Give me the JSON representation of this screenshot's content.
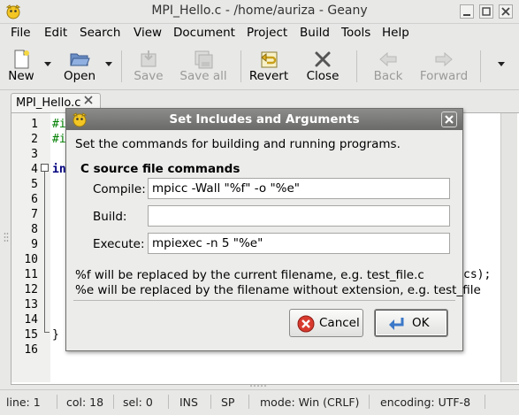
{
  "window": {
    "title": "MPI_Hello.c - /home/auriza - Geany",
    "icon": "geany-icon",
    "controls": [
      "minimize-icon",
      "maximize-icon",
      "close-icon"
    ]
  },
  "menubar": {
    "items": [
      {
        "label": "File"
      },
      {
        "label": "Edit"
      },
      {
        "label": "Search"
      },
      {
        "label": "View"
      },
      {
        "label": "Document"
      },
      {
        "label": "Project"
      },
      {
        "label": "Build"
      },
      {
        "label": "Tools"
      },
      {
        "label": "Help"
      }
    ]
  },
  "toolbar": {
    "buttons": [
      {
        "label": "New",
        "icon": "new-file-icon",
        "enabled": true
      },
      {
        "label": "Open",
        "icon": "open-folder-icon",
        "enabled": true
      },
      {
        "label": "Save",
        "icon": "save-icon",
        "enabled": false
      },
      {
        "label": "Save all",
        "icon": "save-all-icon",
        "enabled": false
      },
      {
        "label": "Revert",
        "icon": "revert-icon",
        "enabled": true
      },
      {
        "label": "Close",
        "icon": "close-x-icon",
        "enabled": true
      },
      {
        "label": "Back",
        "icon": "back-arrow-icon",
        "enabled": false
      },
      {
        "label": "Forward",
        "icon": "forward-arrow-icon",
        "enabled": false
      }
    ]
  },
  "editor": {
    "tab": {
      "label": "MPI_Hello.c"
    },
    "line_numbers": [
      "1",
      "2",
      "3",
      "4",
      "5",
      "6",
      "7",
      "8",
      "9",
      "10",
      "11",
      "12",
      "13",
      "14",
      "15",
      "16"
    ],
    "visible_code": {
      "line1": "#i",
      "line2": "#i",
      "line4": "in",
      "line11": "cs);",
      "line15": "}"
    }
  },
  "dialog": {
    "title": "Set Includes and Arguments",
    "description": "Set the commands for building and running programs.",
    "section_title": "C source file commands",
    "fields": {
      "compile": {
        "label": "Compile:",
        "value": "mpicc -Wall \"%f\" -o \"%e\""
      },
      "build": {
        "label": "Build:",
        "value": ""
      },
      "execute": {
        "label": "Execute:",
        "value": "mpiexec -n 5 \"%e\""
      }
    },
    "notes": {
      "line1": "%f will be replaced by the current filename, e.g. test_file.c",
      "line2": "%e will be replaced by the filename without extension, e.g. test_file"
    },
    "buttons": {
      "cancel": "Cancel",
      "ok": "OK"
    }
  },
  "statusbar": {
    "line": "line: 1",
    "col": "col: 18",
    "sel": "sel: 0",
    "ins": "INS",
    "sp": "SP",
    "mode": "mode: Win (CRLF)",
    "encoding": "encoding: UTF-8"
  },
  "colors": {
    "window_bg": "#e8e8e7",
    "dialog_title_bg": "#7a7a78",
    "gutter_bg": "#f0f0ee",
    "code_preprocessor": "#007f00",
    "code_keyword": "#00007f",
    "cancel_icon": "#d83a2e",
    "ok_icon": "#3b78c8"
  }
}
